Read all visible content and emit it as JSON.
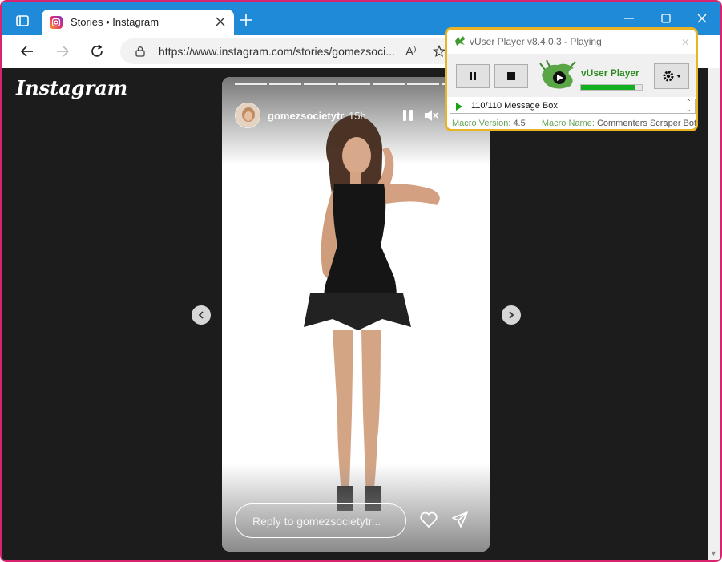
{
  "browser": {
    "tab_title": "Stories • Instagram",
    "url": "https://www.instagram.com/stories/gomezsoci..."
  },
  "page": {
    "logo_text": "Instagram"
  },
  "story": {
    "username": "gomezsocietytr",
    "time_ago": "15h",
    "reply_placeholder": "Reply to gomezsocietytr...",
    "segments_count": 7,
    "active_segment": 7
  },
  "vuser_player": {
    "title": "vUser Player v8.4.0.3 - Playing",
    "brand": "vUser Player",
    "progress": 0.88,
    "status_text": "110/110 Message Box",
    "macro_version_label": "Macro Version:",
    "macro_version": "4.5",
    "macro_name_label": "Macro Name:",
    "macro_name": "Commenters Scraper Bot.vu"
  },
  "colors": {
    "browser_accent": "#1f8ad8",
    "window_border": "#d8246e",
    "instagram_bg": "#1c1c1c",
    "vuser_border": "#e8b324",
    "vuser_green": "#2a8a1e"
  },
  "icons": {
    "tab_actions": "tab-actions-icon",
    "favicon": "instagram-favicon",
    "back": "back-arrow-icon",
    "forward": "forward-arrow-icon",
    "refresh": "refresh-icon",
    "lock": "lock-icon",
    "read_aloud": "read-aloud-icon",
    "favorite": "star-icon",
    "prev": "chevron-left-icon",
    "next": "chevron-right-icon",
    "pause": "pause-icon",
    "mute": "mute-icon",
    "like": "heart-icon",
    "share": "send-icon",
    "settings": "gear-icon"
  }
}
